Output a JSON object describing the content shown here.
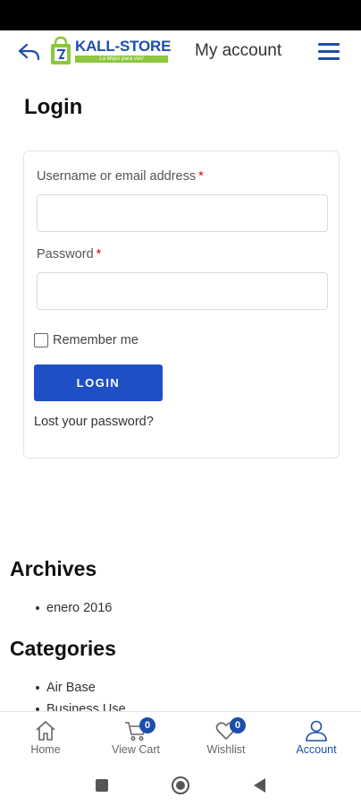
{
  "header": {
    "logo_text": "KALL-STORE",
    "logo_slogan": "La Mejor para vos!",
    "title": "My account",
    "accent_color": "#1d4faa",
    "logo_green": "#8dc63f"
  },
  "login": {
    "page_title": "Login",
    "username_label": "Username or email address",
    "password_label": "Password",
    "required_mark": "*",
    "username_value": "",
    "password_value": "",
    "remember_label": "Remember me",
    "remember_checked": false,
    "button_label": "LOGIN",
    "button_color": "#1e4fc4",
    "lost_password": "Lost your password?"
  },
  "archives": {
    "title": "Archives",
    "items": [
      "enero 2016"
    ]
  },
  "categories": {
    "title": "Categories",
    "items": [
      "Air Base",
      "Business Use"
    ]
  },
  "bottom_nav": {
    "items": [
      {
        "label": "Home",
        "icon": "home-icon"
      },
      {
        "label": "View Cart",
        "icon": "cart-icon",
        "badge": "0"
      },
      {
        "label": "Wishlist",
        "icon": "heart-icon",
        "badge": "0"
      },
      {
        "label": "Account",
        "icon": "user-icon",
        "active": true
      }
    ]
  },
  "system_nav": {
    "icons": [
      "square-recents-icon",
      "circle-home-icon",
      "triangle-back-icon"
    ]
  }
}
